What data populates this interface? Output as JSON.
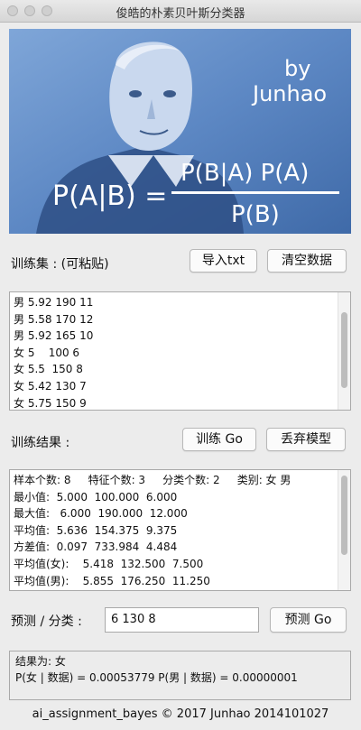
{
  "window": {
    "title": "俊皓的朴素贝叶斯分类器"
  },
  "banner": {
    "by_text": "by",
    "author": "Junhao",
    "formula_lhs": "P(A|B) =",
    "formula_num": "P(B|A) P(A)",
    "formula_den": "P(B)"
  },
  "train": {
    "label": "训练集 : (可粘贴)",
    "import_btn": "导入txt",
    "clear_btn": "清空数据",
    "lines": [
      "男 5.92 190 11",
      "男 5.58 170 12",
      "男 5.92 165 10",
      "女 5    100 6",
      "女 5.5  150 8",
      "女 5.42 130 7",
      "女 5.75 150 9"
    ]
  },
  "result_section": {
    "label": "训练结果 :",
    "train_btn": "训练 Go",
    "discard_btn": "丢弃模型",
    "lines": [
      "样本个数: 8     特征个数: 3     分类个数: 2     类别: 女 男",
      "最小值:  5.000  100.000  6.000",
      "最大值:   6.000  190.000  12.000",
      "平均值:  5.636  154.375  9.375",
      "方差值:  0.097  733.984  4.484",
      "平均值(女):    5.418  132.500  7.500",
      "平均值(男):    5.855  176.250  11.250"
    ]
  },
  "predict": {
    "label": "预测 / 分类 :",
    "input_value": "6 130 8",
    "btn": "预测 Go"
  },
  "output": {
    "line1": "结果为: 女",
    "line2": "P(女 | 数据) = 0.00053779    P(男 | 数据) = 0.00000001"
  },
  "footer": "ai_assignment_bayes © 2017 Junhao 2014101027"
}
